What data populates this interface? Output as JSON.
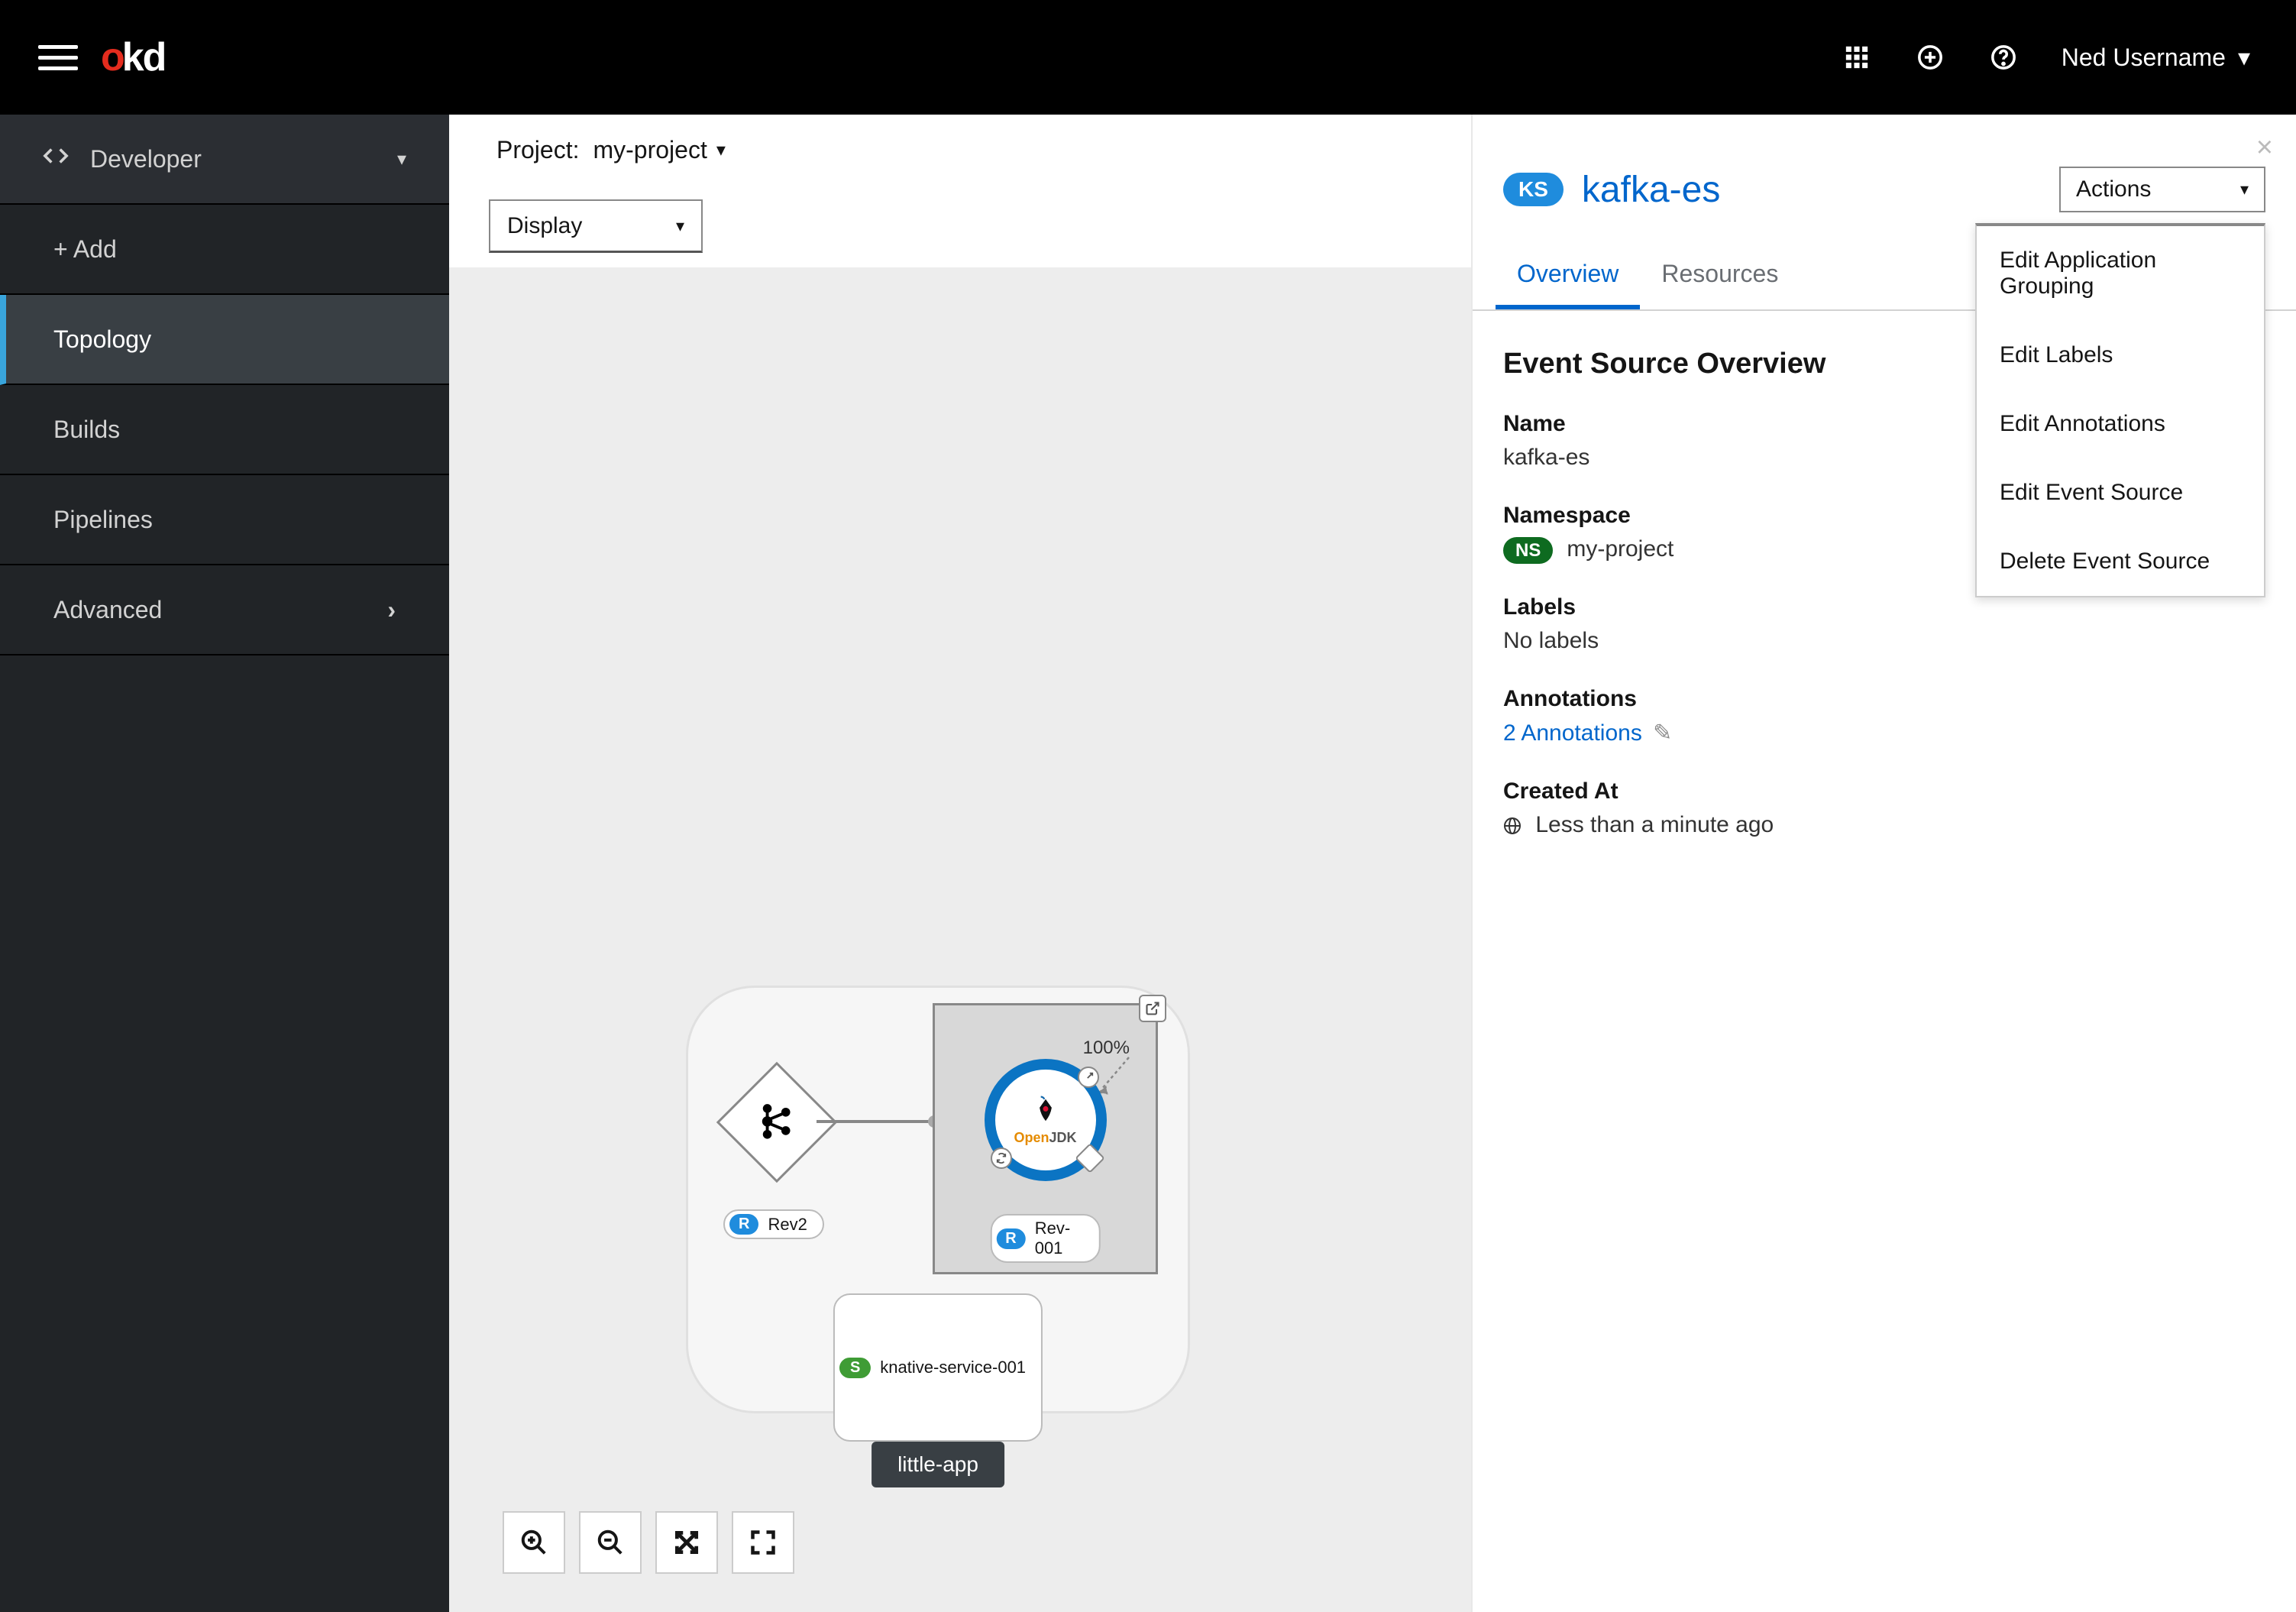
{
  "masthead": {
    "brand_o": "o",
    "brand_kd": "kd",
    "username": "Ned Username"
  },
  "sidebar": {
    "perspective": "Developer",
    "items": [
      {
        "label": "+ Add"
      },
      {
        "label": "Topology"
      },
      {
        "label": "Builds"
      },
      {
        "label": "Pipelines"
      },
      {
        "label": "Advanced"
      }
    ]
  },
  "project_bar": {
    "label": "Project:",
    "name": "my-project"
  },
  "display_bar": {
    "display": "Display"
  },
  "topology": {
    "app_group_label": "little-app",
    "event_source_label": "Rev2",
    "revision_label": "Rev-001",
    "traffic_pct": "100%",
    "node_tech_prefix": "Open",
    "node_tech_suffix": "JDK",
    "kn_service_label": "knative-service-001"
  },
  "side_panel": {
    "badge": "KS",
    "title": "kafka-es",
    "actions_label": "Actions",
    "actions_menu": [
      "Edit Application Grouping",
      "Edit Labels",
      "Edit Annotations",
      "Edit Event Source",
      "Delete Event Source"
    ],
    "tabs": {
      "overview": "Overview",
      "resources": "Resources"
    },
    "overview": {
      "section_title": "Event Source Overview",
      "name_label": "Name",
      "name_value": "kafka-es",
      "namespace_label": "Namespace",
      "namespace_badge": "NS",
      "namespace_value": "my-project",
      "labels_label": "Labels",
      "labels_value": "No labels",
      "annotations_label": "Annotations",
      "annotations_value": "2 Annotations",
      "created_label": "Created At",
      "created_value": "Less than a minute ago"
    }
  }
}
